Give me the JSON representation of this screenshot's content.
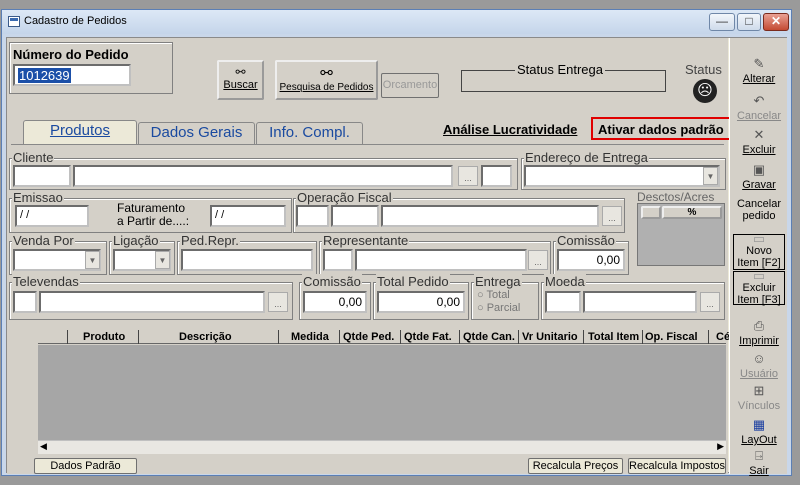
{
  "window": {
    "title": "Cadastro de Pedidos",
    "min": "—",
    "max": "□",
    "close": "✕"
  },
  "pedido": {
    "label": "Número do Pedido",
    "value": "1012639"
  },
  "buttons": {
    "buscar": "Buscar",
    "pesquisa": "Pesquisa de Pedidos",
    "orcamento": "Orcamento",
    "dados_padrao": "Dados Padrão",
    "recalcula_precos": "Recalcula Preços",
    "recalcula_impostos": "Recalcula Impostos"
  },
  "status": {
    "entrega_label": "Status Entrega",
    "status_label": "Status"
  },
  "tabs": [
    "Produtos",
    "Dados Gerais",
    "Info. Compl."
  ],
  "links": {
    "analise": "Análise Lucratividade",
    "ativar": "Ativar dados padrão"
  },
  "form": {
    "cliente": "Cliente",
    "endereco": "Endereço de Entrega",
    "emissao": "Emissao",
    "emissao_value": "/ /",
    "faturamento": "Faturamento",
    "faturamento2": "a Partir de....:",
    "faturamento_value": "/ /",
    "operacao": "Operação Fiscal",
    "descontos": "Desctos/Acres",
    "descontos_value": "%",
    "venda_por": "Venda Por",
    "ligacao": "Ligação",
    "ped_repr": "Ped.Repr.",
    "representante": "Representante",
    "comissao": "Comissão",
    "comissao_value": "0,00",
    "televendas": "Televendas",
    "comissao2": "Comissão",
    "comissao2_value": "0,00",
    "total_pedido": "Total Pedido",
    "total_pedido_value": "0,00",
    "entrega": "Entrega",
    "entrega_total": "Total",
    "entrega_parcial": "Parcial",
    "moeda": "Moeda",
    "dots": "..."
  },
  "grid": {
    "columns": [
      "Produto",
      "Descrição",
      "Medida",
      "Qtde Ped.",
      "Qtde Fat.",
      "Qtde Can.",
      "Vr Unitario",
      "Total Item",
      "Op. Fiscal",
      "Cé"
    ]
  },
  "sidebar": [
    {
      "label": "Alterar",
      "icon": "edit-icon"
    },
    {
      "label": "Cancelar",
      "icon": "undo-icon"
    },
    {
      "label": "Excluir",
      "icon": "delete-icon"
    },
    {
      "label": "Gravar",
      "icon": "save-icon"
    },
    {
      "label": "Cancelar pedido",
      "icon": ""
    },
    {
      "label": "Novo Item [F2]",
      "icon": "add-item-icon"
    },
    {
      "label": "Excluir Item [F3]",
      "icon": "remove-item-icon"
    },
    {
      "label": "Imprimir",
      "icon": "print-icon"
    },
    {
      "label": "Usuário",
      "icon": "user-icon"
    },
    {
      "label": "Vínculos",
      "icon": "links-icon"
    },
    {
      "label": "LayOut",
      "icon": "layout-icon"
    },
    {
      "label": "Sair",
      "icon": "exit-icon"
    }
  ]
}
